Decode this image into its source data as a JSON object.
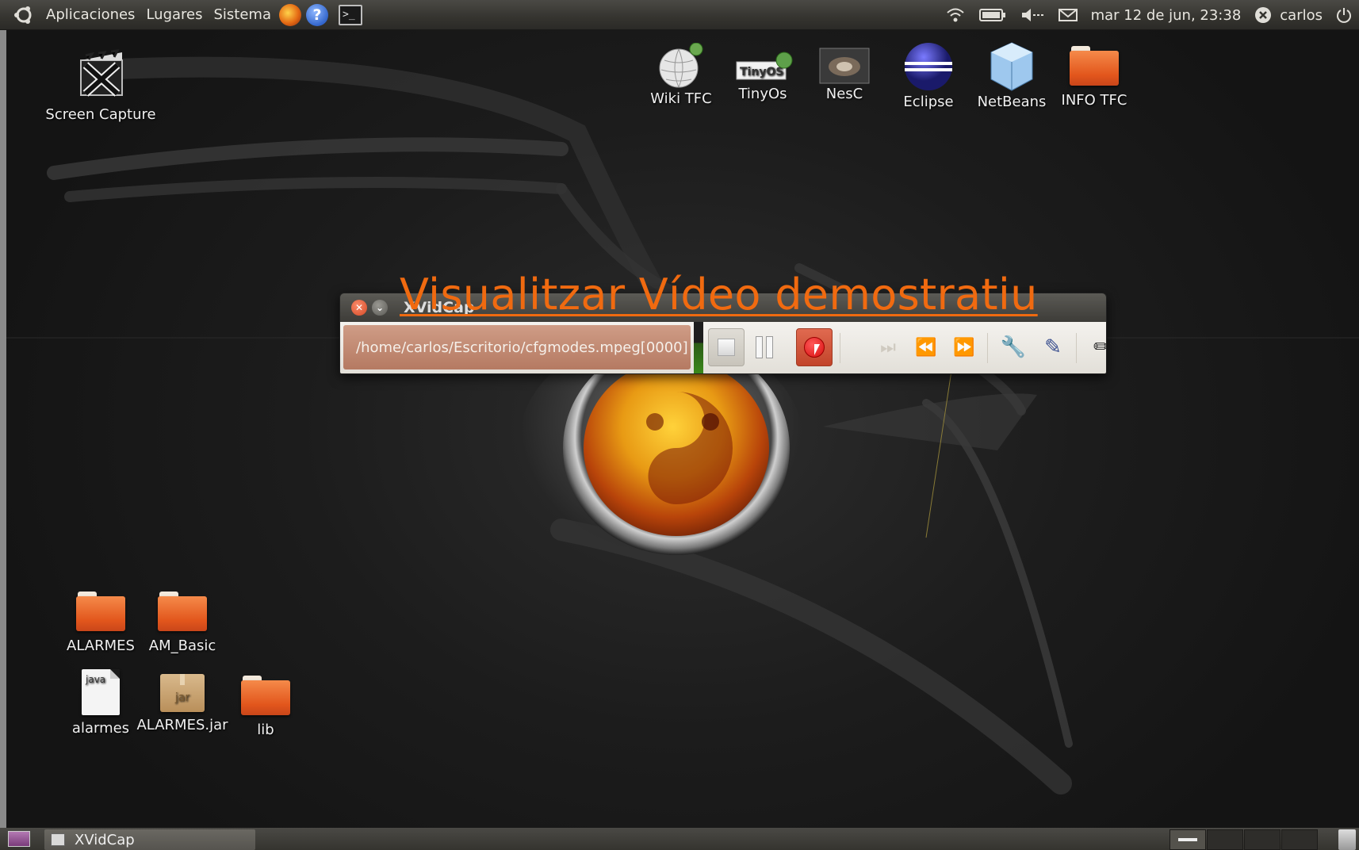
{
  "top_panel": {
    "menus": [
      "Aplicaciones",
      "Lugares",
      "Sistema"
    ],
    "help_glyph": "?",
    "terminal_glyph": ">_",
    "clock": "mar 12 de jun, 23:38",
    "user": "carlos"
  },
  "desktop": {
    "top_icons": [
      {
        "label": "Screen Capture",
        "icon": "screen-capture-icon"
      },
      {
        "label": "Wiki TFC",
        "icon": "wikipedia-icon"
      },
      {
        "label": "TinyOs",
        "icon": "tinyos-icon"
      },
      {
        "label": "NesC",
        "icon": "nesc-icon"
      },
      {
        "label": "Eclipse",
        "icon": "eclipse-icon"
      },
      {
        "label": "NetBeans",
        "icon": "netbeans-icon"
      },
      {
        "label": "INFO TFC",
        "icon": "folder-icon"
      }
    ],
    "bottom_icons": [
      {
        "label": "ALARMES",
        "icon": "folder-icon"
      },
      {
        "label": "AM_Basic",
        "icon": "folder-icon"
      },
      {
        "label": "alarmes",
        "icon": "java-file-icon",
        "badge": "java"
      },
      {
        "label": "ALARMES.jar",
        "icon": "jar-file-icon",
        "badge": "jar"
      },
      {
        "label": "lib",
        "icon": "folder-icon"
      }
    ]
  },
  "overlay": {
    "title": "Visualitzar Vídeo demostratiu"
  },
  "xvidcap": {
    "window_title": "XVidCap",
    "file_path": "/home/carlos/Escritorio/cfgmodes.mpeg[0000]",
    "recording": true
  },
  "bottom_panel": {
    "task_label": "XVidCap"
  },
  "colors": {
    "overlay_text": "#f06a10",
    "panel": "#3b3a36",
    "folder": "#e8622a",
    "record": "#d80e0e"
  }
}
